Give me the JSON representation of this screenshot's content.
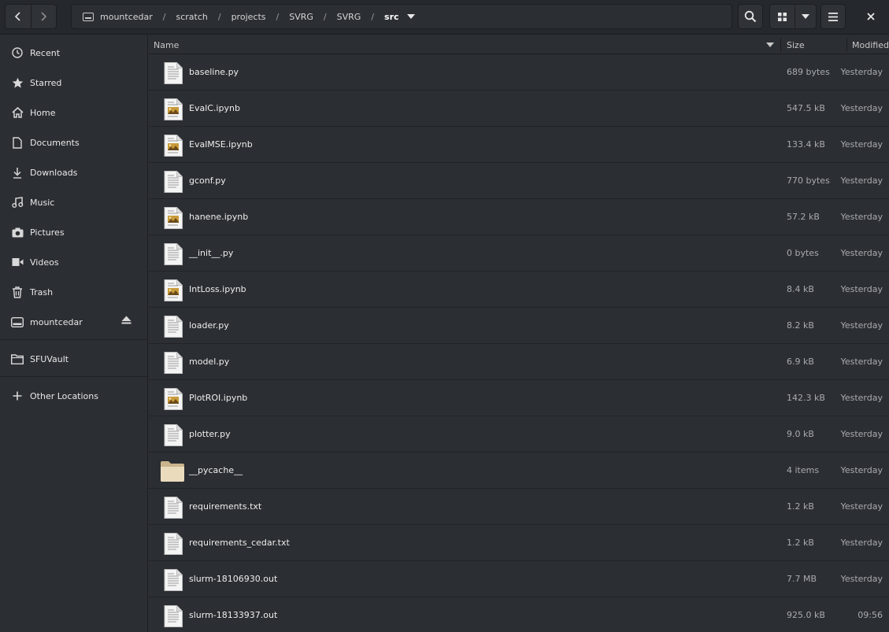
{
  "header": {
    "path": [
      "mountcedar",
      "scratch",
      "projects",
      "SVRG",
      "SVRG",
      "src"
    ],
    "separator": "/"
  },
  "sidebar": {
    "items": [
      {
        "label": "Recent",
        "icon": "clock-icon"
      },
      {
        "label": "Starred",
        "icon": "star-icon"
      },
      {
        "label": "Home",
        "icon": "home-icon"
      },
      {
        "label": "Documents",
        "icon": "document-icon"
      },
      {
        "label": "Downloads",
        "icon": "download-icon"
      },
      {
        "label": "Music",
        "icon": "music-icon"
      },
      {
        "label": "Pictures",
        "icon": "camera-icon"
      },
      {
        "label": "Videos",
        "icon": "video-icon"
      },
      {
        "label": "Trash",
        "icon": "trash-icon"
      },
      {
        "label": "mountcedar",
        "icon": "drive-icon"
      }
    ],
    "bookmark": {
      "label": "SFUVault",
      "icon": "folder-icon"
    },
    "other": {
      "label": "Other Locations",
      "icon": "plus-icon"
    }
  },
  "columns": {
    "name": "Name",
    "size": "Size",
    "modified": "Modified"
  },
  "files": [
    {
      "name": "baseline.py",
      "size": "689 bytes",
      "modified": "Yesterday",
      "type": "text"
    },
    {
      "name": "EvalC.ipynb",
      "size": "547.5 kB",
      "modified": "Yesterday",
      "type": "notebook"
    },
    {
      "name": "EvalMSE.ipynb",
      "size": "133.4 kB",
      "modified": "Yesterday",
      "type": "notebook"
    },
    {
      "name": "gconf.py",
      "size": "770 bytes",
      "modified": "Yesterday",
      "type": "text"
    },
    {
      "name": "hanene.ipynb",
      "size": "57.2 kB",
      "modified": "Yesterday",
      "type": "notebook"
    },
    {
      "name": "__init__.py",
      "size": "0 bytes",
      "modified": "Yesterday",
      "type": "text"
    },
    {
      "name": "IntLoss.ipynb",
      "size": "8.4 kB",
      "modified": "Yesterday",
      "type": "notebook"
    },
    {
      "name": "loader.py",
      "size": "8.2 kB",
      "modified": "Yesterday",
      "type": "text"
    },
    {
      "name": "model.py",
      "size": "6.9 kB",
      "modified": "Yesterday",
      "type": "text"
    },
    {
      "name": "PlotROI.ipynb",
      "size": "142.3 kB",
      "modified": "Yesterday",
      "type": "notebook"
    },
    {
      "name": "plotter.py",
      "size": "9.0 kB",
      "modified": "Yesterday",
      "type": "text"
    },
    {
      "name": "__pycache__",
      "size": "4 items",
      "modified": "Yesterday",
      "type": "folder"
    },
    {
      "name": "requirements.txt",
      "size": "1.2 kB",
      "modified": "Yesterday",
      "type": "text"
    },
    {
      "name": "requirements_cedar.txt",
      "size": "1.2 kB",
      "modified": "Yesterday",
      "type": "text"
    },
    {
      "name": "slurm-18106930.out",
      "size": "7.7 MB",
      "modified": "Yesterday",
      "type": "text"
    },
    {
      "name": "slurm-18133937.out",
      "size": "925.0 kB",
      "modified": "09:56",
      "type": "text"
    }
  ],
  "colors": {
    "background": "#2b2e33",
    "header": "#25282c",
    "text": "#eeeeec",
    "muted": "#a9abad"
  }
}
